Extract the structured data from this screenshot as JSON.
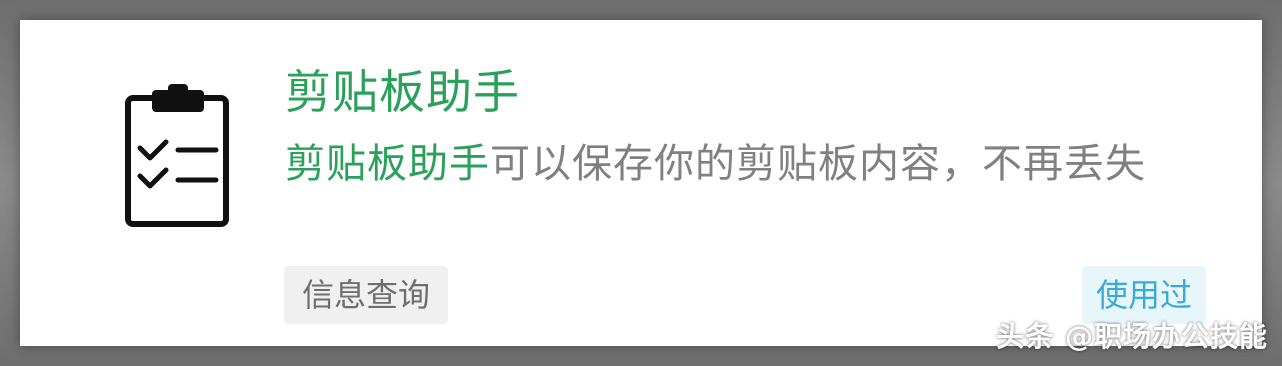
{
  "item": {
    "icon": "clipboard-checklist-icon",
    "title": "剪贴板助手",
    "description_highlight": "剪贴板助手",
    "description_rest": "可以保存你的剪贴板内容，不再丢失",
    "tag": "信息查询",
    "status_badge": "使用过"
  },
  "colors": {
    "accent_green": "#2aa05a",
    "text_gray": "#808080",
    "badge_blue": "#3aaad6",
    "badge_blue_bg": "#e6f6fb",
    "tag_bg": "#f0f0f0"
  },
  "watermark": "头条 @职场办公技能"
}
